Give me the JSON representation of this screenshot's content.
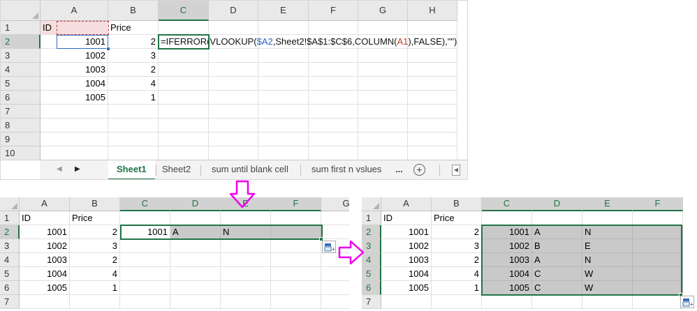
{
  "colors": {
    "accent": "#217346",
    "arrow": "#ee00ee",
    "fill": "#c9c9c9",
    "header_bg": "#e9e9e9"
  },
  "top": {
    "columns": [
      "A",
      "B",
      "C",
      "D",
      "E",
      "F",
      "G",
      "H"
    ],
    "rows": [
      "1",
      "2",
      "3",
      "4",
      "5",
      "6",
      "7",
      "8",
      "9",
      "10"
    ],
    "cells": [
      [
        "ID",
        "Price"
      ],
      [
        "1001",
        "2"
      ],
      [
        "1002",
        "3"
      ],
      [
        "1003",
        "2"
      ],
      [
        "1004",
        "4"
      ],
      [
        "1005",
        "1"
      ]
    ],
    "formula_parts": [
      "=IFERROR(VLOOKUP(",
      "$A2",
      ",Sheet2!$A$1:$C$6,COLUMN(",
      "A1",
      "),FALSE),\"\")"
    ],
    "tabs": [
      "Sheet1",
      "Sheet2",
      "sum until blank cell",
      "sum first n vslues",
      "..."
    ],
    "add_sheet": "+"
  },
  "bottom_left": {
    "columns": [
      "A",
      "B",
      "C",
      "D",
      "E",
      "F",
      "G"
    ],
    "rows": [
      "1",
      "2",
      "3",
      "4",
      "5",
      "6",
      "7"
    ],
    "cells": [
      [
        "ID",
        "Price",
        "",
        "",
        "",
        ""
      ],
      [
        "1001",
        "2",
        "1001",
        "A",
        "N",
        ""
      ],
      [
        "1002",
        "3",
        "",
        "",
        "",
        ""
      ],
      [
        "1003",
        "2",
        "",
        "",
        "",
        ""
      ],
      [
        "1004",
        "4",
        "",
        "",
        "",
        ""
      ],
      [
        "1005",
        "1",
        "",
        "",
        "",
        ""
      ],
      [
        "",
        "",
        "",
        "",
        "",
        ""
      ]
    ]
  },
  "bottom_right": {
    "columns": [
      "A",
      "B",
      "C",
      "D",
      "E",
      "F"
    ],
    "rows": [
      "1",
      "2",
      "3",
      "4",
      "5",
      "6",
      "7"
    ],
    "cells": [
      [
        "ID",
        "Price",
        "",
        "",
        "",
        ""
      ],
      [
        "1001",
        "2",
        "1001",
        "A",
        "N",
        ""
      ],
      [
        "1002",
        "3",
        "1002",
        "B",
        "E",
        ""
      ],
      [
        "1003",
        "2",
        "1003",
        "A",
        "N",
        ""
      ],
      [
        "1004",
        "4",
        "1004",
        "C",
        "W",
        ""
      ],
      [
        "1005",
        "1",
        "1005",
        "C",
        "W",
        ""
      ],
      [
        "",
        "",
        "",
        "",
        "",
        ""
      ]
    ]
  }
}
